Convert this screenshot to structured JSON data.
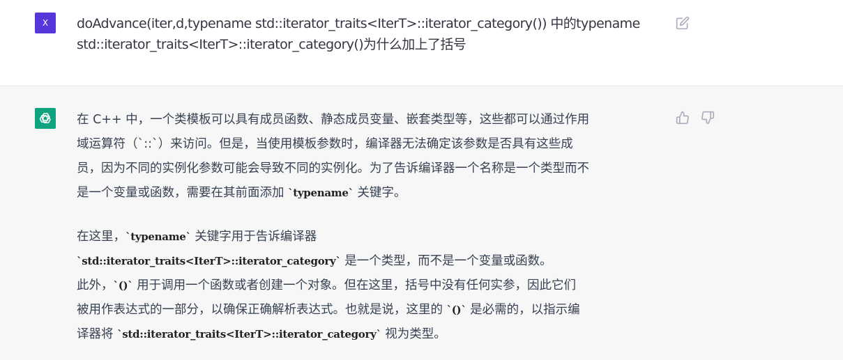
{
  "user_message": {
    "avatar_letter": "X",
    "line1": "doAdvance(iter,d,typename std::iterator_traits<IterT>::iterator_category()) 中的typename",
    "line2": "std::iterator_traits<IterT>::iterator_category()为什么加上了括号",
    "edit_icon": "edit-icon"
  },
  "assistant_message": {
    "avatar_icon": "openai-logo-icon",
    "paragraph1": {
      "line1": "在 C++ 中，一个类模板可以具有成员函数、静态成员变量、嵌套类型等，这些都可以通过作用",
      "line2": "域运算符（`::`）来访问。但是，当使用模板参数时，编译器无法确定该参数是否具有这些成",
      "line3": "员，因为不同的实例化参数可能会导致不同的实例化。为了告诉编译器一个名称是一个类型而不",
      "line4_pre": "是一个变量或函数，需要在其前面添加 ",
      "line4_code": "`typename`",
      "line4_post": " 关键字。"
    },
    "paragraph2": {
      "line1_pre": "在这里，",
      "line1_code": "`typename`",
      "line1_post": " 关键字用于告诉编译器",
      "line2_code": "`std::iterator_traits<IterT>::iterator_category`",
      "line2_post": " 是一个类型，而不是一个变量或函数。",
      "line3_pre": "此外，",
      "line3_code": "`()`",
      "line3_post": " 用于调用一个函数或者创建一个对象。但在这里，括号中没有任何实参，因此它们",
      "line4_pre": "被用作表达式的一部分，以确保正确解析表达式。也就是说，这里的 ",
      "line4_code": "`()`",
      "line4_post": " 是必需的，以指示编",
      "line5_pre": "译器将 ",
      "line5_code": "`std::iterator_traits<IterT>::iterator_category`",
      "line5_post": " 视为类型。"
    },
    "thumb_up_icon": "thumb-up-icon",
    "thumb_down_icon": "thumb-down-icon"
  },
  "colors": {
    "user_avatar": "#5436da",
    "assistant_avatar": "#10a37f",
    "assistant_background": "#f7f7f8"
  }
}
